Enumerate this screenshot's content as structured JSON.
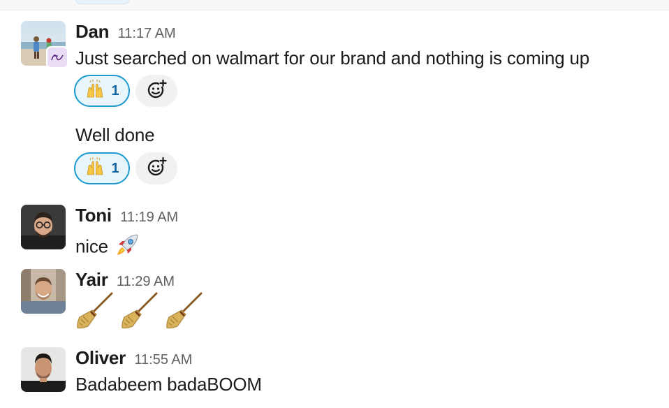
{
  "messages": [
    {
      "name": "Dan",
      "time": "11:17 AM",
      "text": "Just searched on walmart for our brand and nothing is coming up",
      "reaction": {
        "emoji": "raising-hands",
        "count": "1"
      }
    },
    {
      "text": "Well done",
      "reaction": {
        "emoji": "raising-hands",
        "count": "1"
      }
    },
    {
      "name": "Toni",
      "time": "11:19 AM",
      "text": "nice",
      "emoji": "rocket"
    },
    {
      "name": "Yair",
      "time": "11:29 AM",
      "emojis": [
        "broom",
        "broom",
        "broom"
      ]
    },
    {
      "name": "Oliver",
      "time": "11:55 AM",
      "text": "Badabeem badaBOOM"
    }
  ],
  "colors": {
    "reaction_border": "#1d9bd1",
    "reaction_bg": "#e8f5fa",
    "reaction_count": "#1264a3",
    "timestamp": "#616061"
  }
}
